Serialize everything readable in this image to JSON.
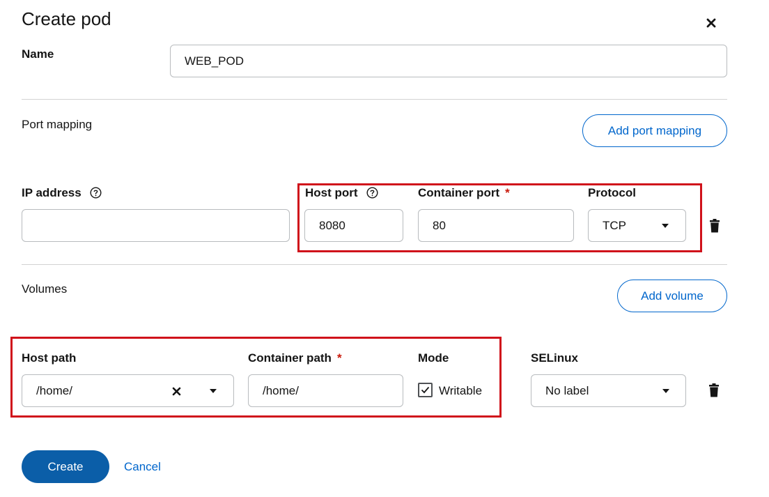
{
  "dialog": {
    "title": "Create pod"
  },
  "name_field": {
    "label": "Name",
    "value": "WEB_POD"
  },
  "port_mapping": {
    "section_label": "Port mapping",
    "add_button": "Add port mapping",
    "ip_address": {
      "label": "IP address",
      "value": ""
    },
    "host_port": {
      "label": "Host port",
      "value": "8080"
    },
    "container_port": {
      "label": "Container port",
      "required_mark": "*",
      "value": "80"
    },
    "protocol": {
      "label": "Protocol",
      "value": "TCP"
    }
  },
  "volumes": {
    "section_label": "Volumes",
    "add_button": "Add volume",
    "host_path": {
      "label": "Host path",
      "value": "/home/"
    },
    "container_path": {
      "label": "Container path",
      "required_mark": "*",
      "value": "/home/"
    },
    "mode": {
      "label": "Mode",
      "checkbox_label": "Writable",
      "checked": true
    },
    "selinux": {
      "label": "SELinux",
      "value": "No label"
    }
  },
  "footer": {
    "create_label": "Create",
    "cancel_label": "Cancel"
  },
  "colors": {
    "accent": "#0066cc",
    "primary_button": "#0b5ea8",
    "required": "#c9190b",
    "highlight": "#d0121b"
  }
}
